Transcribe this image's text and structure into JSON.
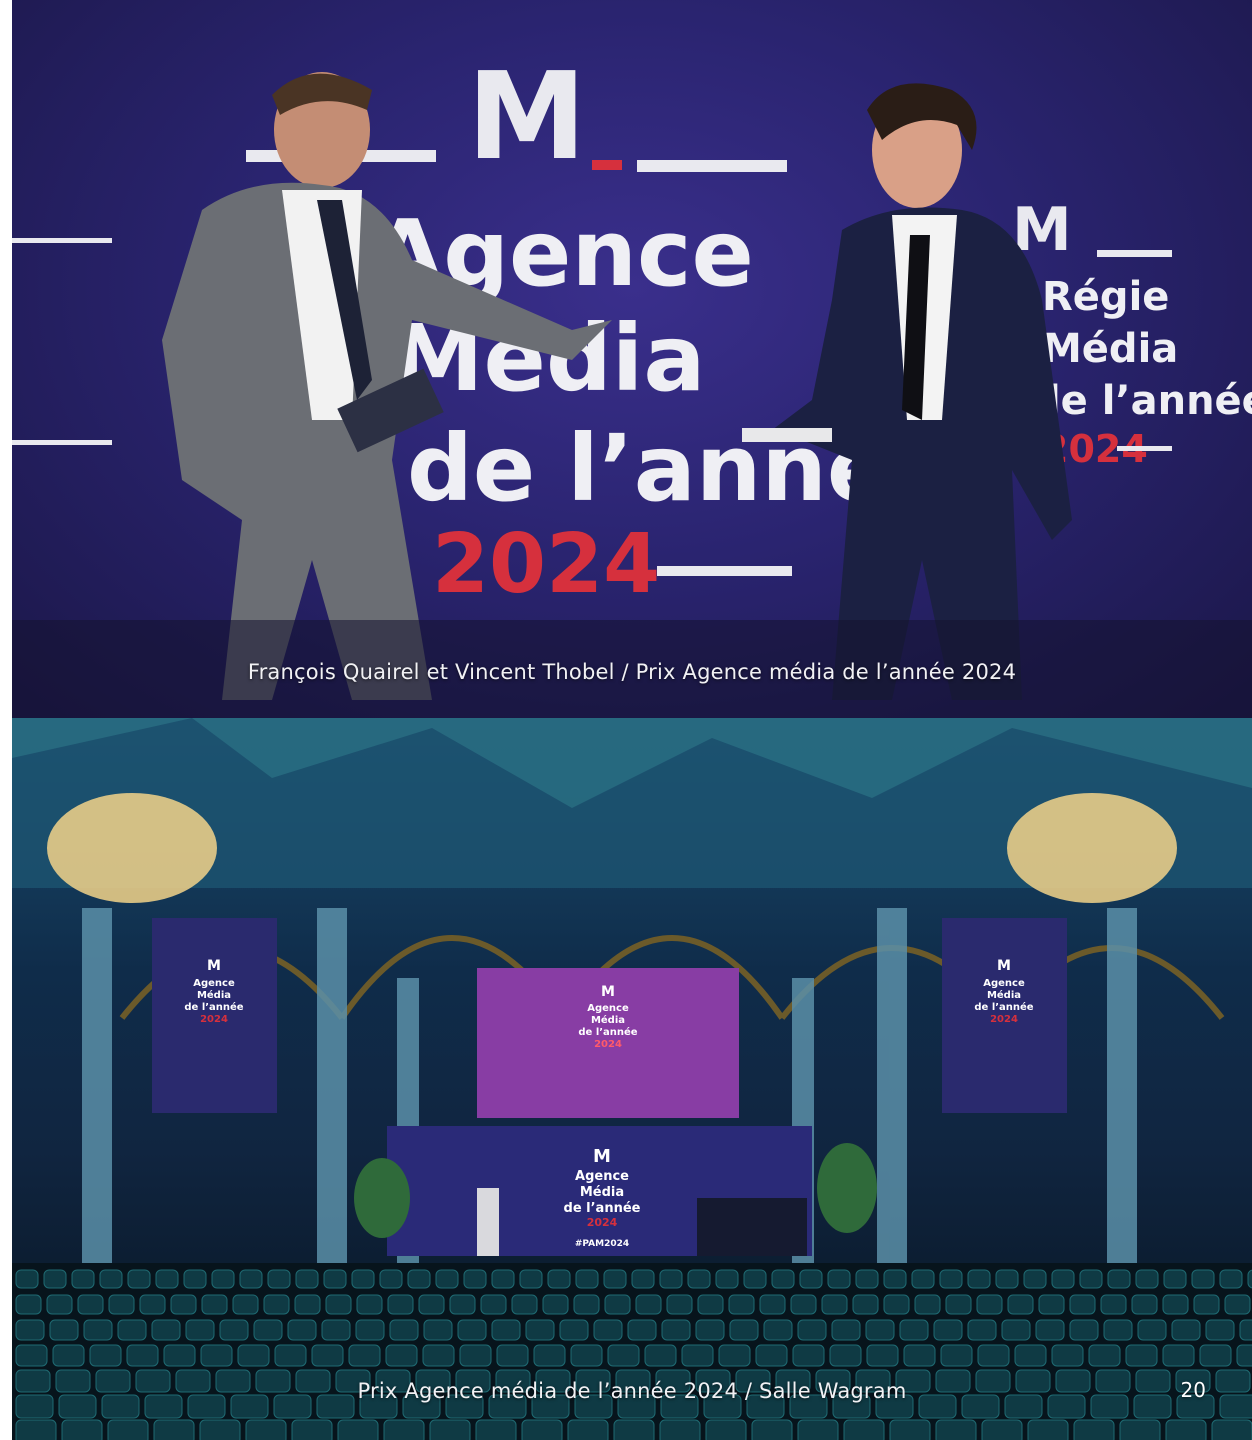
{
  "top_photo": {
    "alt": "",
    "caption": "François Quairel et Vincent Thobel / Prix Agence média de l’année 2024",
    "backdrop": {
      "logo_letter": "M",
      "line1": "Agence",
      "line2": "Média",
      "line3": "de l’année",
      "year": "2024",
      "side_lines": [
        "Régie",
        "Média",
        "de l’année",
        "2024"
      ]
    },
    "colors": {
      "backdrop": "#2a2470",
      "accent_red": "#d6303d"
    }
  },
  "bottom_photo": {
    "caption": "Prix Agence média de l’année 2024 / Salle Wagram",
    "screen_lines": [
      "M",
      "Agence",
      "Média",
      "de l’année",
      "2024"
    ],
    "hashtag": "#PAM2024"
  },
  "page_number": "20"
}
